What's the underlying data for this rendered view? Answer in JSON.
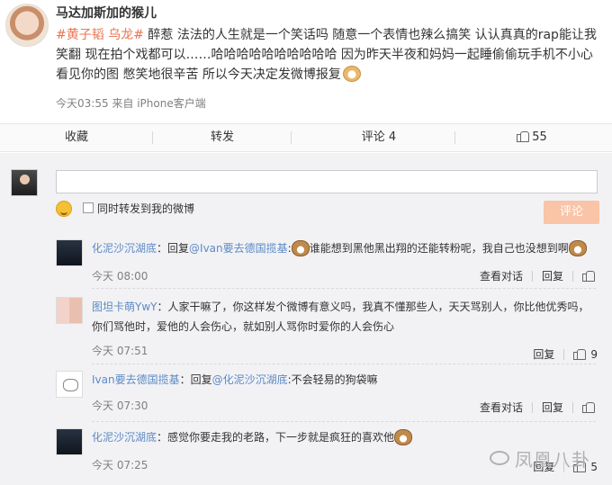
{
  "post": {
    "author": "马达加斯加的猴儿",
    "tag1": "#黄子韬 乌龙#",
    "text": " 醉惹 法法的人生就是一个笑话吗 随意一个表情也辣么搞笑 认认真真的rap能让我笑翻 现在拍个戏都可以……哈哈哈哈哈哈哈哈哈哈 因为昨天半夜和妈妈一起睡偷偷玩手机不小心看见你的图 憋笑地很辛苦 所以今天决定发微博报复",
    "meta": "今天03:55 来自 iPhone客户端"
  },
  "actions": {
    "collect": "收藏",
    "forward": "转发",
    "comment": "评论 4",
    "like": "55"
  },
  "compose": {
    "checkbox_label": "同时转发到我的微博",
    "submit": "评论"
  },
  "comments": [
    {
      "name": "化泥沙沉湖底",
      "prefix": "：回复",
      "at": "@Ivan要去德国揽基",
      "body": "谁能想到黑他黑出翔的还能转粉呢，我自己也没想到啊",
      "time": "今天 08:00",
      "view_dialog": "查看对话",
      "reply": "回复",
      "likes": ""
    },
    {
      "name": "图坦卡萌YwY",
      "prefix": "：",
      "at": "",
      "body": "人家干嘛了，你这样发个微博有意义吗，我真不懂那些人，天天骂别人，你比他优秀吗，你们骂他时，爱他的人会伤心，就如别人骂你时爱你的人会伤心",
      "time": "今天 07:51",
      "view_dialog": "",
      "reply": "回复",
      "likes": "9"
    },
    {
      "name": "Ivan要去德国揽基",
      "prefix": "：回复",
      "at": "@化泥沙沉湖底",
      "body": ":不会轻易的狗袋嘛",
      "time": "今天 07:30",
      "view_dialog": "查看对话",
      "reply": "回复",
      "likes": ""
    },
    {
      "name": "化泥沙沉湖底",
      "prefix": "：",
      "at": "",
      "body": "感觉你要走我的老路，下一步就是疯狂的喜欢他",
      "time": "今天 07:25",
      "view_dialog": "",
      "reply": "回复",
      "likes": "5"
    }
  ],
  "watermark": "凤凰八卦"
}
